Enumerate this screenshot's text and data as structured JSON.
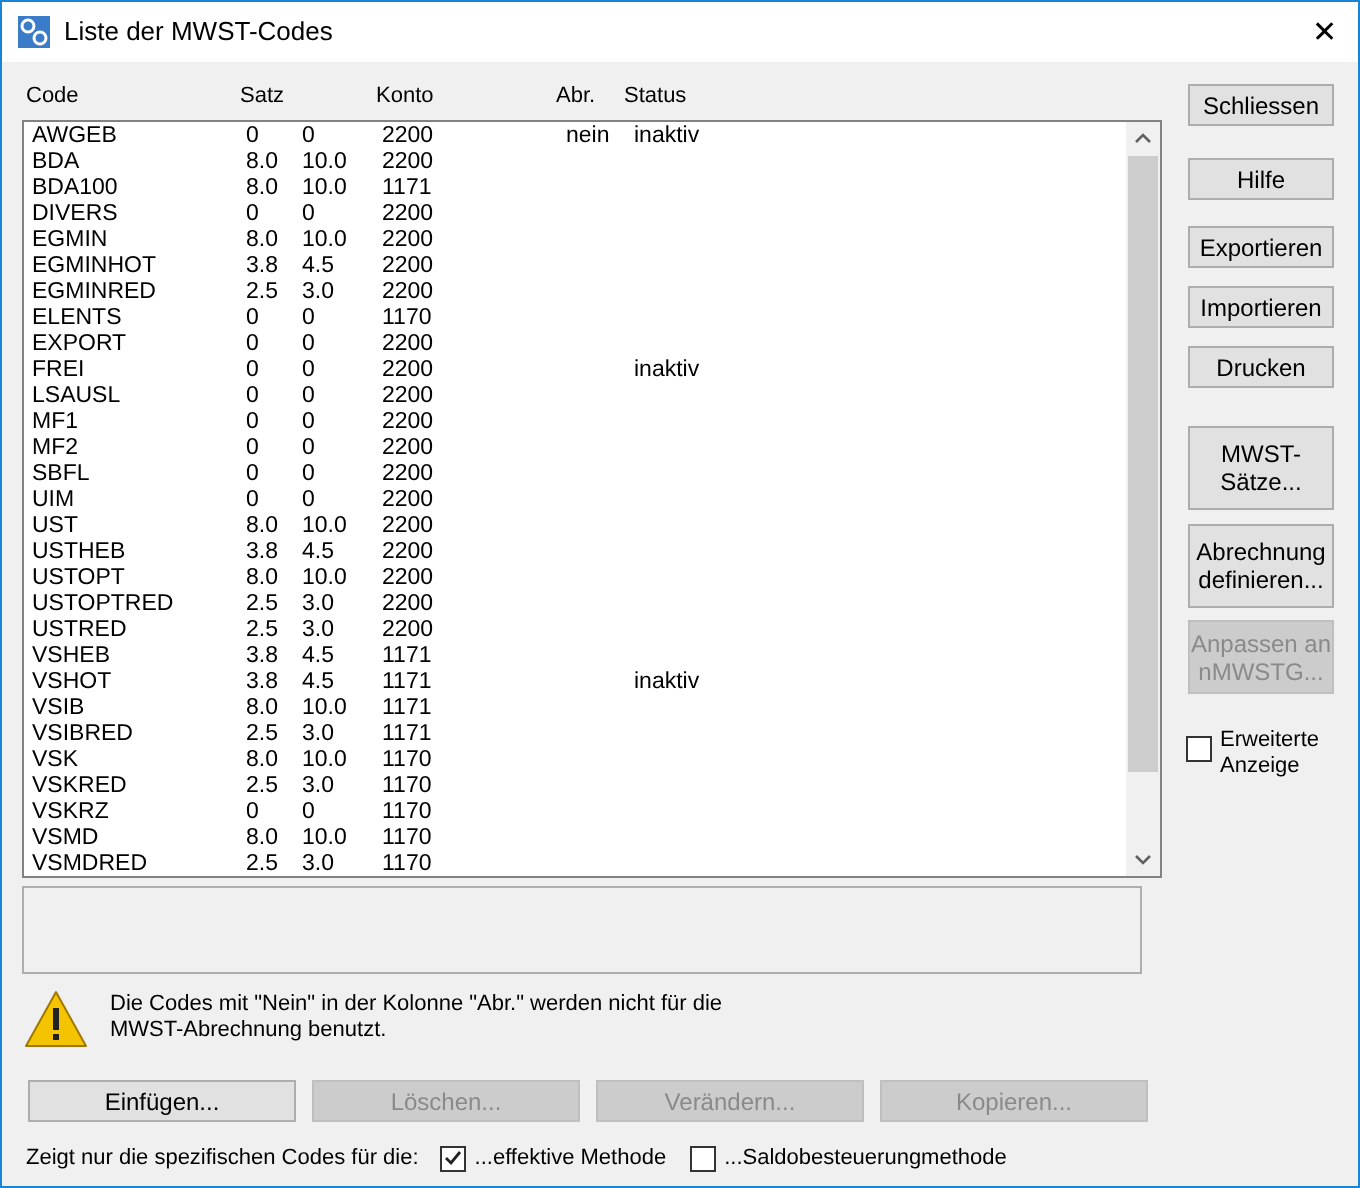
{
  "window": {
    "title": "Liste der MWST-Codes",
    "close_glyph": "✕"
  },
  "table": {
    "columns": [
      "Code",
      "Satz",
      "Konto",
      "Abr.",
      "Status"
    ],
    "rows": [
      {
        "code": "AWGEB",
        "satz_1": "0",
        "satz_2": "0",
        "konto": "2200",
        "abr": "nein",
        "status": "inaktiv"
      },
      {
        "code": "BDA",
        "satz_1": "8.0",
        "satz_2": "10.0",
        "konto": "2200"
      },
      {
        "code": "BDA100",
        "satz_1": "8.0",
        "satz_2": "10.0",
        "konto": "1171"
      },
      {
        "code": "DIVERS",
        "satz_1": "0",
        "satz_2": "0",
        "konto": "2200"
      },
      {
        "code": "EGMIN",
        "satz_1": "8.0",
        "satz_2": "10.0",
        "konto": "2200"
      },
      {
        "code": "EGMINHOT",
        "satz_1": "3.8",
        "satz_2": "4.5",
        "konto": "2200"
      },
      {
        "code": "EGMINRED",
        "satz_1": "2.5",
        "satz_2": "3.0",
        "konto": "2200"
      },
      {
        "code": "ELENTS",
        "satz_1": "0",
        "satz_2": "0",
        "konto": "1170"
      },
      {
        "code": "EXPORT",
        "satz_1": "0",
        "satz_2": "0",
        "konto": "2200"
      },
      {
        "code": "FREI",
        "satz_1": "0",
        "satz_2": "0",
        "konto": "2200",
        "status": "inaktiv"
      },
      {
        "code": "LSAUSL",
        "satz_1": "0",
        "satz_2": "0",
        "konto": "2200"
      },
      {
        "code": "MF1",
        "satz_1": "0",
        "satz_2": "0",
        "konto": "2200"
      },
      {
        "code": "MF2",
        "satz_1": "0",
        "satz_2": "0",
        "konto": "2200"
      },
      {
        "code": "SBFL",
        "satz_1": "0",
        "satz_2": "0",
        "konto": "2200"
      },
      {
        "code": "UIM",
        "satz_1": "0",
        "satz_2": "0",
        "konto": "2200"
      },
      {
        "code": "UST",
        "satz_1": "8.0",
        "satz_2": "10.0",
        "konto": "2200"
      },
      {
        "code": "USTHEB",
        "satz_1": "3.8",
        "satz_2": "4.5",
        "konto": "2200"
      },
      {
        "code": "USTOPT",
        "satz_1": "8.0",
        "satz_2": "10.0",
        "konto": "2200"
      },
      {
        "code": "USTOPTRED",
        "satz_1": "2.5",
        "satz_2": "3.0",
        "konto": "2200"
      },
      {
        "code": "USTRED",
        "satz_1": "2.5",
        "satz_2": "3.0",
        "konto": "2200"
      },
      {
        "code": "VSHEB",
        "satz_1": "3.8",
        "satz_2": "4.5",
        "konto": "1171"
      },
      {
        "code": "VSHOT",
        "satz_1": "3.8",
        "satz_2": "4.5",
        "konto": "1171",
        "status": "inaktiv"
      },
      {
        "code": "VSIB",
        "satz_1": "8.0",
        "satz_2": "10.0",
        "konto": "1171"
      },
      {
        "code": "VSIBRED",
        "satz_1": "2.5",
        "satz_2": "3.0",
        "konto": "1171"
      },
      {
        "code": "VSK",
        "satz_1": "8.0",
        "satz_2": "10.0",
        "konto": "1170"
      },
      {
        "code": "VSKRED",
        "satz_1": "2.5",
        "satz_2": "3.0",
        "konto": "1170"
      },
      {
        "code": "VSKRZ",
        "satz_1": "0",
        "satz_2": "0",
        "konto": "1170"
      },
      {
        "code": "VSMD",
        "satz_1": "8.0",
        "satz_2": "10.0",
        "konto": "1170"
      },
      {
        "code": "VSMDRED",
        "satz_1": "2.5",
        "satz_2": "3.0",
        "konto": "1170"
      }
    ]
  },
  "side_buttons": [
    {
      "label": "Schliessen",
      "disabled": false
    },
    {
      "label": "Hilfe",
      "disabled": false
    },
    {
      "label": "Exportieren",
      "disabled": false
    },
    {
      "label": "Importieren",
      "disabled": false
    },
    {
      "label": "Drucken",
      "disabled": false
    },
    {
      "label": "MWST-\nSätze...",
      "disabled": false
    },
    {
      "label": "Abrechnung\ndefinieren...",
      "disabled": false
    },
    {
      "label": "Anpassen an\nnMWSTG...",
      "disabled": true
    }
  ],
  "extended_view": {
    "label": "Erweiterte\nAnzeige",
    "checked": false
  },
  "warning": "Die Codes mit \"Nein\" in der Kolonne \"Abr.\" werden nicht für die\nMWST-Abrechnung benutzt.",
  "action_buttons": [
    {
      "label": "Einfügen...",
      "disabled": false
    },
    {
      "label": "Löschen...",
      "disabled": true
    },
    {
      "label": "Verändern...",
      "disabled": true
    },
    {
      "label": "Kopieren...",
      "disabled": true
    }
  ],
  "filter": {
    "label": "Zeigt nur die spezifischen Codes für die:",
    "options": [
      {
        "label": "...effektive Methode",
        "checked": true
      },
      {
        "label": "...Saldobesteuerungmethode",
        "checked": false
      }
    ]
  }
}
